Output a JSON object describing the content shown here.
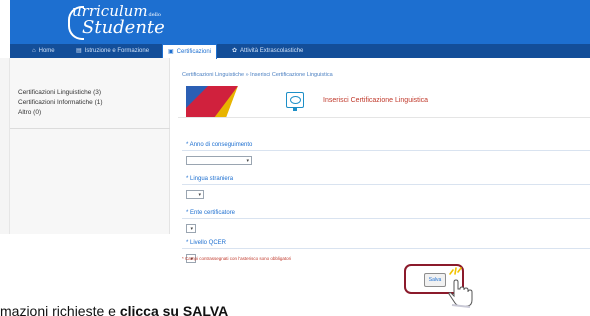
{
  "header": {
    "logo_top": "urriculum",
    "logo_small": "dello",
    "logo_bottom": "Studente"
  },
  "nav": {
    "items": [
      {
        "label": "Home",
        "icon": "home-icon"
      },
      {
        "label": "Istruzione e Formazione",
        "icon": "education-icon"
      },
      {
        "label": "Certificazioni",
        "icon": "certificate-icon"
      },
      {
        "label": "Attività Extrascolastiche",
        "icon": "activity-icon"
      }
    ]
  },
  "sidebar": {
    "items": [
      {
        "label": "Certificazioni Linguistiche (3)"
      },
      {
        "label": "Certificazioni Informatiche (1)"
      },
      {
        "label": "Altro (0)"
      }
    ]
  },
  "main": {
    "breadcrumb": "Certificazioni Linguistiche » Inserisci Certificazione Linguistica",
    "title": "Inserisci Certificazione Linguistica",
    "fields": [
      {
        "label": "* Anno di conseguimento"
      },
      {
        "label": "* Lingua straniera"
      },
      {
        "label": "* Ente certificatore"
      },
      {
        "label": "* Livello QCER"
      }
    ],
    "note": "* Campi contrassegnati con l'asterisco sono obbligatori",
    "save_label": "Salva"
  },
  "caption": {
    "text": "mazioni richieste e ",
    "bold": "clicca su SALVA"
  },
  "colors": {
    "header": "#1d6fd0",
    "nav": "#134e99",
    "accent": "#c0392b",
    "highlight": "#8b1a2b"
  }
}
